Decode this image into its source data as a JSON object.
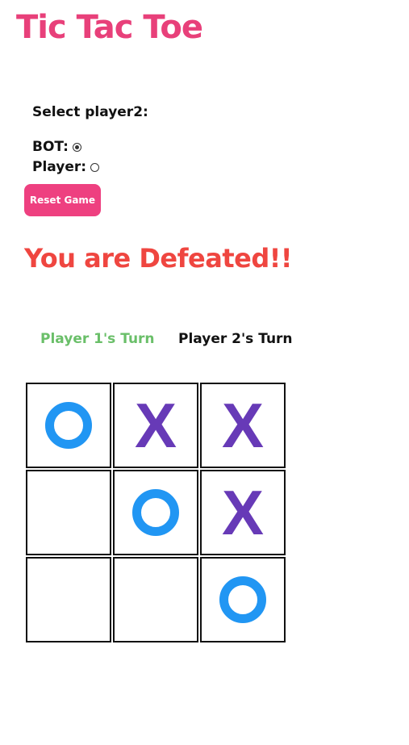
{
  "title": "Tic Tac Toe",
  "select_label": "Select player2:",
  "options": [
    {
      "label": "BOT:",
      "checked": true
    },
    {
      "label": "Player:",
      "checked": false
    }
  ],
  "reset_label": "Reset Game",
  "result_text": "You are Defeated!!",
  "turns": {
    "player1": "Player 1's Turn",
    "player2": "Player 2's Turn"
  },
  "board": [
    [
      "O",
      "X",
      "X"
    ],
    [
      "",
      "O",
      "X"
    ],
    [
      "",
      "",
      "O"
    ]
  ],
  "colors": {
    "title": "#e8407a",
    "reset_button": "#ee4080",
    "result": "#ef4640",
    "player1_turn": "#6abf69",
    "o_mark": "#2196f3",
    "x_mark": "#673ab7"
  }
}
